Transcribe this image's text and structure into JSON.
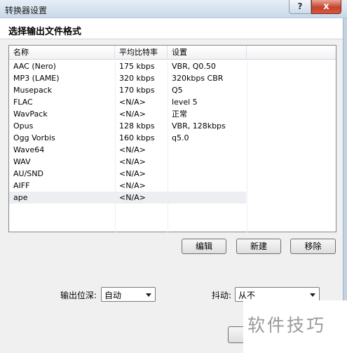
{
  "window": {
    "title": "转换器设置",
    "help_label": "?",
    "close_label": "x"
  },
  "header": {
    "title": "选择输出文件格式"
  },
  "list": {
    "columns": [
      "名称",
      "平均比特率",
      "设置"
    ],
    "rows": [
      {
        "name": "AAC (Nero)",
        "bitrate": "175 kbps",
        "settings": "VBR, Q0.50"
      },
      {
        "name": "MP3 (LAME)",
        "bitrate": "320 kbps",
        "settings": "320kbps CBR"
      },
      {
        "name": "Musepack",
        "bitrate": "170 kbps",
        "settings": "Q5"
      },
      {
        "name": "FLAC",
        "bitrate": "<N/A>",
        "settings": "level 5"
      },
      {
        "name": "WavPack",
        "bitrate": "<N/A>",
        "settings": "正常"
      },
      {
        "name": "Opus",
        "bitrate": "128 kbps",
        "settings": "VBR, 128kbps"
      },
      {
        "name": "Ogg Vorbis",
        "bitrate": "160 kbps",
        "settings": "q5.0"
      },
      {
        "name": "Wave64",
        "bitrate": "<N/A>",
        "settings": ""
      },
      {
        "name": "WAV",
        "bitrate": "<N/A>",
        "settings": ""
      },
      {
        "name": "AU/SND",
        "bitrate": "<N/A>",
        "settings": ""
      },
      {
        "name": "AIFF",
        "bitrate": "<N/A>",
        "settings": ""
      },
      {
        "name": "ape",
        "bitrate": "<N/A>",
        "settings": ""
      }
    ],
    "selected_index": 11
  },
  "buttons": {
    "edit": "编辑",
    "new": "新建",
    "remove": "移除"
  },
  "output_depth": {
    "label": "输出位深:",
    "value": "自动"
  },
  "dither": {
    "label": "抖动:",
    "value": "从不"
  },
  "watermark": {
    "text": "软件技巧"
  }
}
